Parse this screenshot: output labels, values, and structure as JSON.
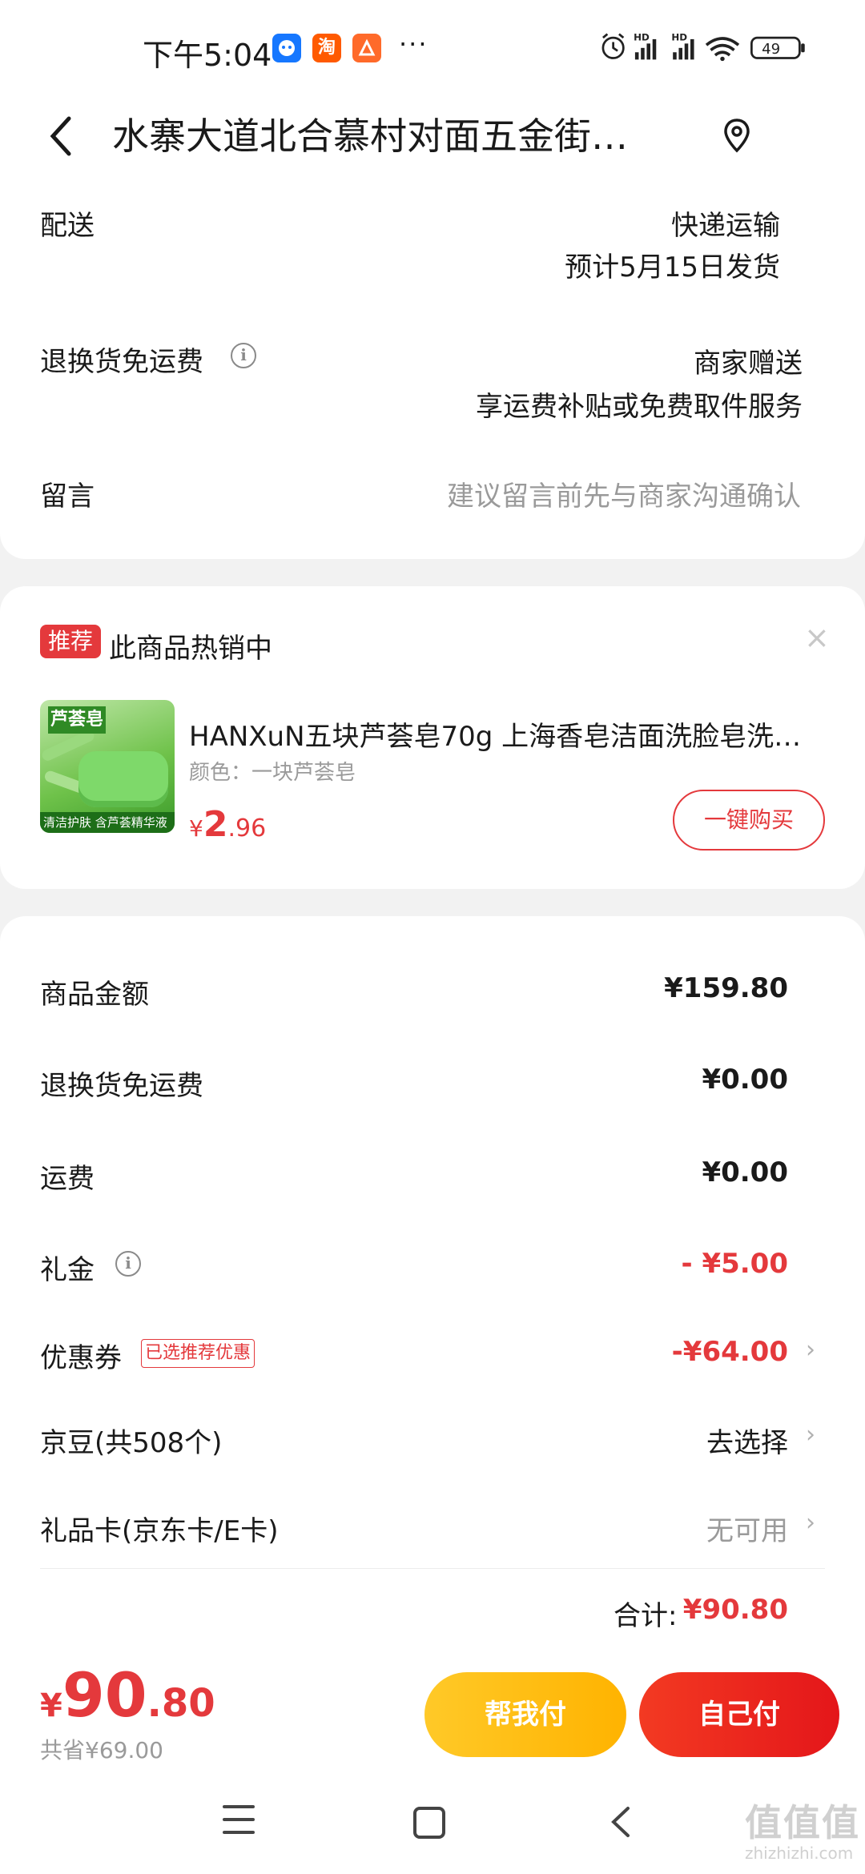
{
  "status_bar": {
    "time": "下午5:04",
    "app_icons": [
      {
        "name": "chat-app-icon",
        "label": "",
        "color": "#1677ff"
      },
      {
        "name": "taobao-icon",
        "label": "淘",
        "color": "#ff5a00"
      },
      {
        "name": "browser-app-icon",
        "label": "",
        "color": "#ff6a2a"
      }
    ],
    "more": "···",
    "network": "HD",
    "battery": "49"
  },
  "header": {
    "back_icon": "chevron-left-icon",
    "title": "水寨大道北合慕村对面五金街…",
    "location_icon": "location-pin-icon"
  },
  "shipping": {
    "delivery_label": "配送",
    "delivery_method": "快递运输",
    "delivery_date": "预计5月15日发货",
    "return_label": "退换货免运费",
    "return_value": "商家赠送",
    "return_desc": "享运费补贴或免费取件服务",
    "note_label": "留言",
    "note_placeholder": "建议留言前先与商家沟通确认"
  },
  "recommend": {
    "tag": "推荐",
    "headline": "此商品热销中",
    "close": "×",
    "product_title": "HANXuN五块芦荟皂70g 上海香皂洁面洗脸皂洗…",
    "product_color": "颜色：一块芦荟皂",
    "thumb_box_text": "芦荟皂",
    "thumb_band_text": "清洁护肤 含芦荟精华液",
    "price_currency": "¥",
    "price_int": "2",
    "price_dec": ".96",
    "buy_button": "一键购买"
  },
  "summary": {
    "rows": [
      {
        "label": "商品金额",
        "value": "¥159.80"
      },
      {
        "label": "退换货免运费",
        "value": "¥0.00"
      },
      {
        "label": "运费",
        "value": "¥0.00"
      },
      {
        "label": "礼金",
        "value": "- ¥5.00"
      },
      {
        "label": "优惠券",
        "tag": "已选推荐优惠",
        "value": "-¥64.00"
      },
      {
        "label": "京豆(共508个)",
        "value": "去选择"
      },
      {
        "label": "礼品卡(京东卡/E卡)",
        "value": "无可用"
      }
    ],
    "total_label": "合计:",
    "total_value": "¥90.80"
  },
  "bottom_bar": {
    "currency": "¥",
    "price_int": "90",
    "price_dec": ".80",
    "saved": "共省¥69.00",
    "help_pay": "帮我付",
    "self_pay": "自己付"
  },
  "watermark": {
    "main": "值值值",
    "sub": "zhizhizhi.com"
  },
  "colors": {
    "accent_red": "#e4393c",
    "help_yellow": "#ffc928",
    "background": "#f2f2f2"
  }
}
